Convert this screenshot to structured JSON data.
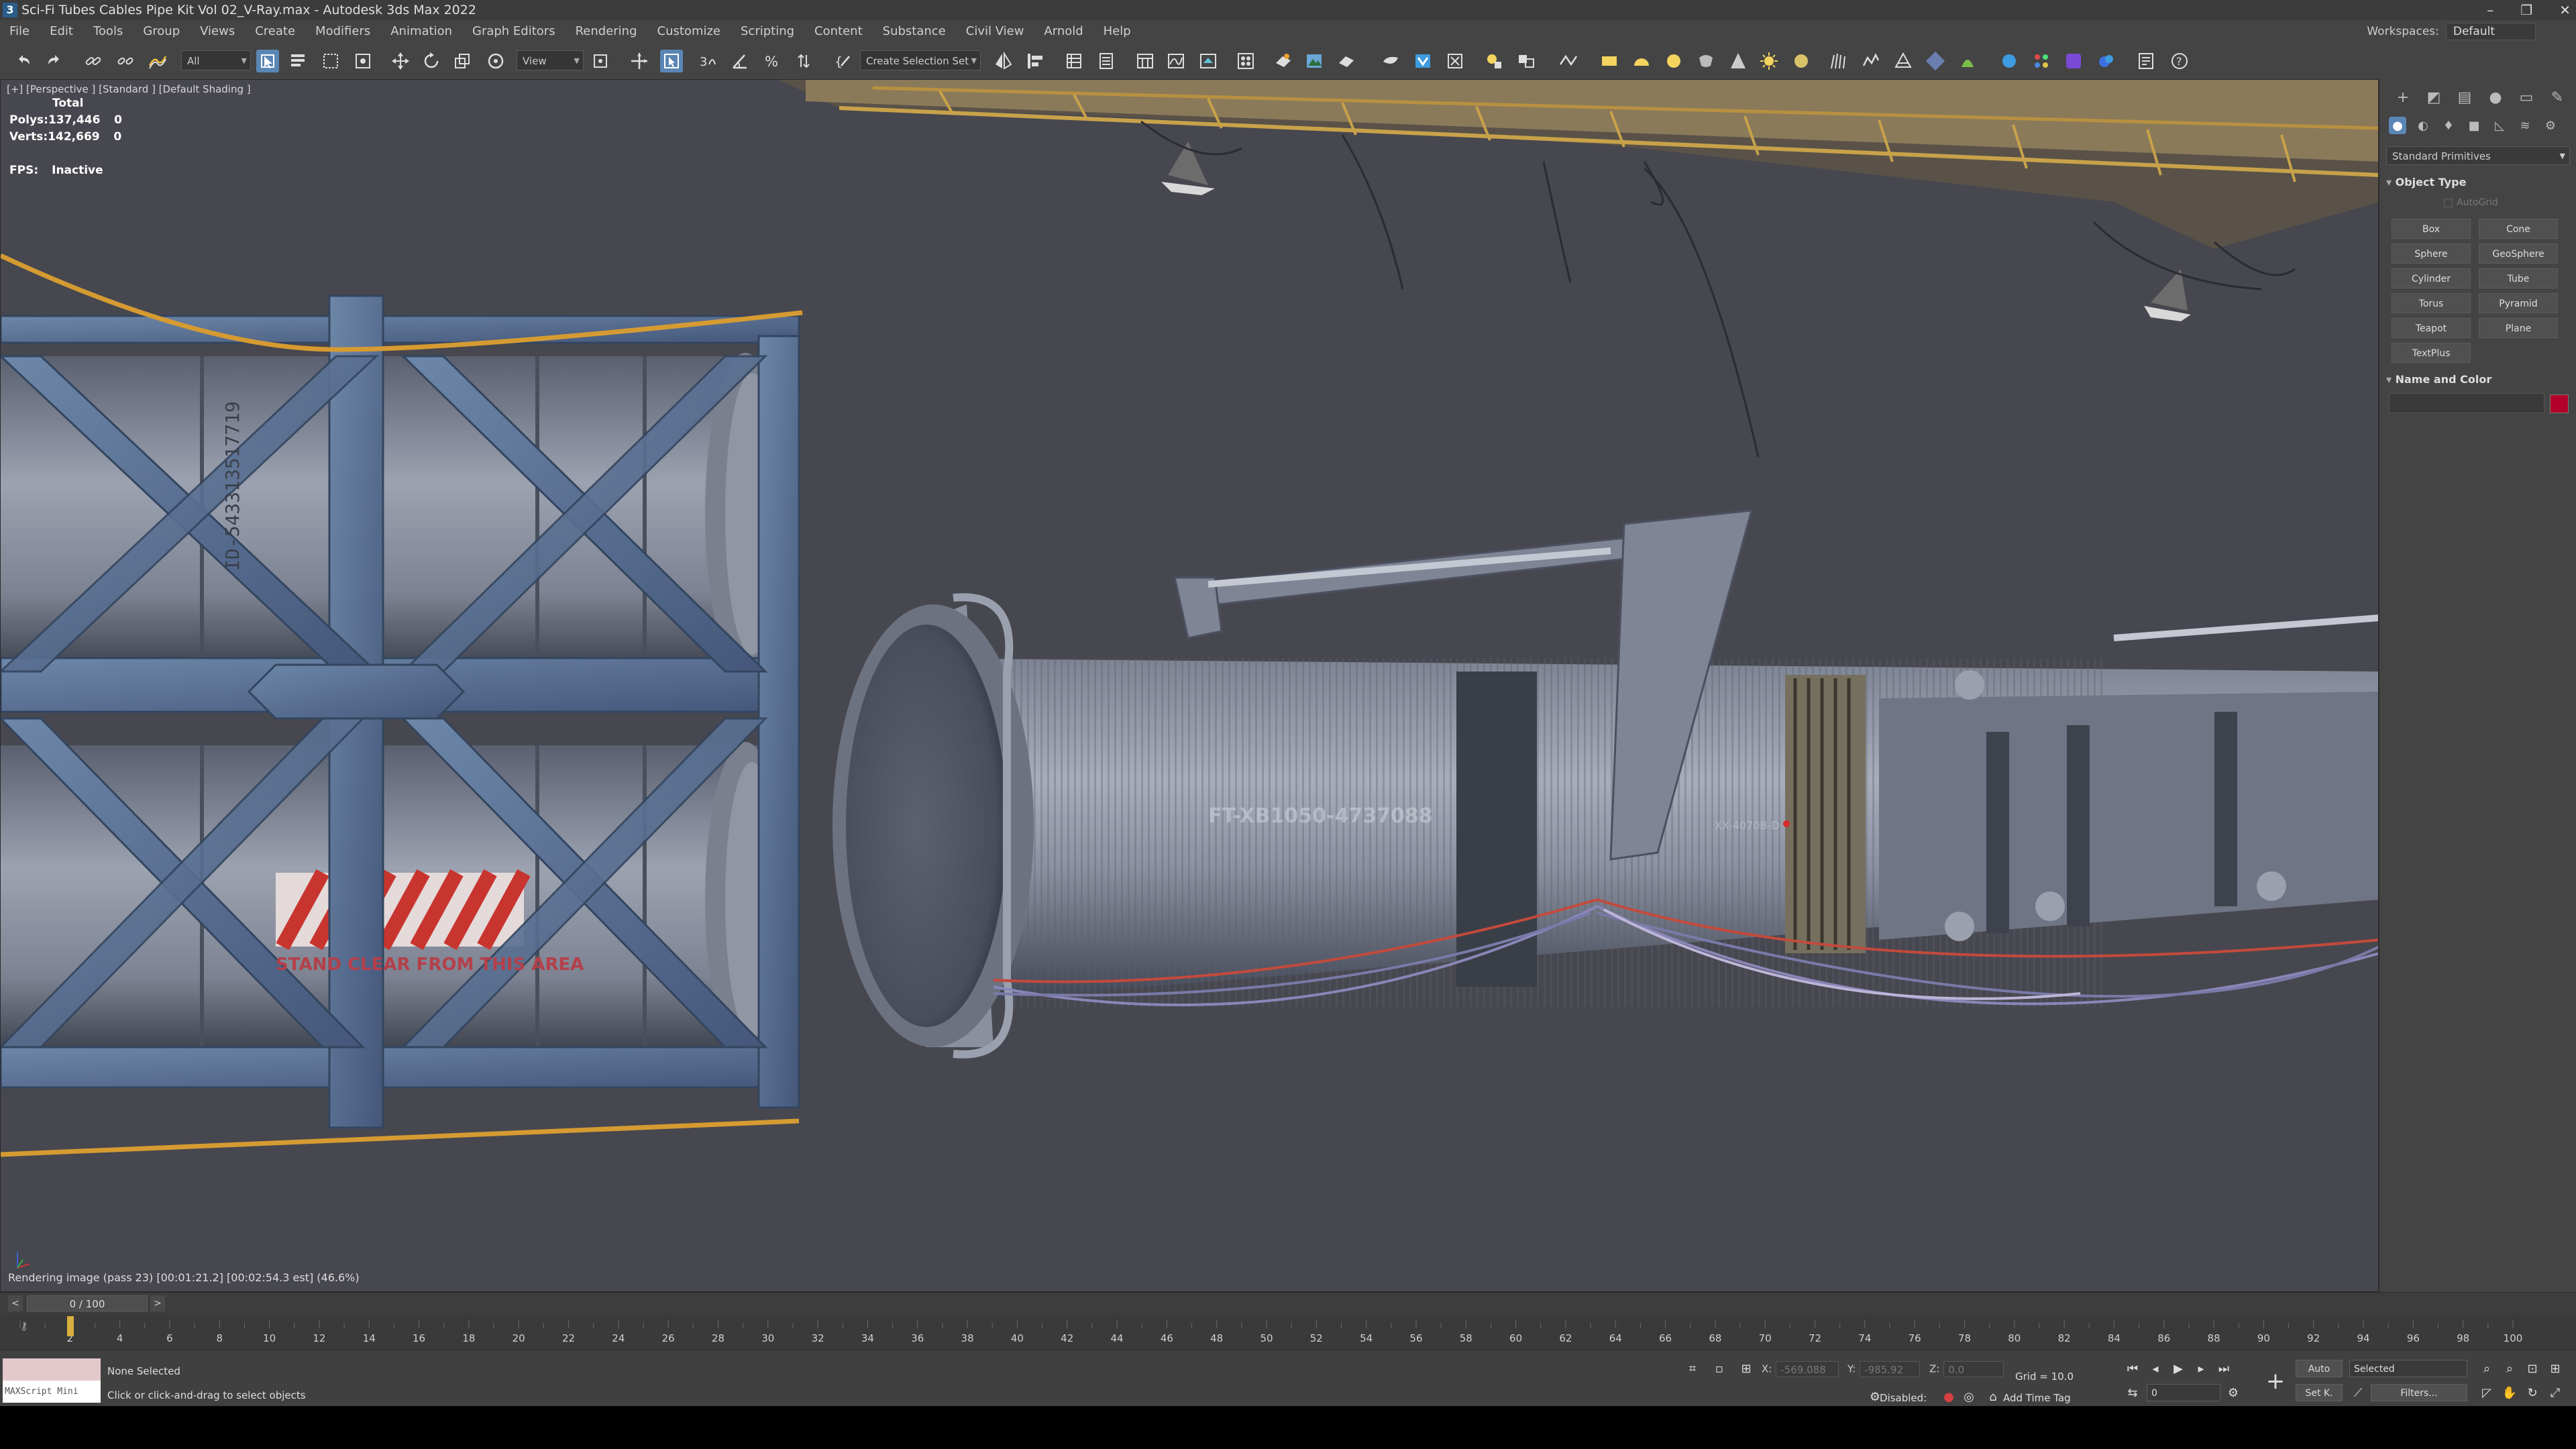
{
  "window": {
    "title": "Sci-Fi Tubes Cables Pipe Kit Vol 02_V-Ray.max - Autodesk 3ds Max 2022",
    "app_icon": "3"
  },
  "menu": [
    "File",
    "Edit",
    "Tools",
    "Group",
    "Views",
    "Create",
    "Modifiers",
    "Animation",
    "Graph Editors",
    "Rendering",
    "Customize",
    "Scripting",
    "Content",
    "Substance",
    "Civil View",
    "Arnold",
    "Help"
  ],
  "workspaces": {
    "label": "Workspaces:",
    "value": "Default"
  },
  "toolbar": {
    "selection_filter": "All",
    "ref_coord": "View",
    "selection_set": "Create Selection Set"
  },
  "viewport": {
    "label": "[+] [Perspective ] [Standard ] [Default Shading ]",
    "stats_header": "Total",
    "polys_label": "Polys:",
    "polys_value": "137,446",
    "polys_sel": "0",
    "verts_label": "Verts:",
    "verts_value": "142,669",
    "verts_sel": "0",
    "fps_label": "FPS:",
    "fps_value": "Inactive",
    "render_status": "Rendering image (pass 23) [00:01:21.2] [00:02:54.3 est]    (46.6%)",
    "decals": {
      "tank_id": "ID-543313517719",
      "warning": "STAND CLEAR FROM THIS AREA",
      "tube_id": "FT-XB1050-4737088",
      "small_id": "XX-4070B-D"
    }
  },
  "command_panel": {
    "category": "Standard Primitives",
    "object_type_title": "Object Type",
    "autogrid": "AutoGrid",
    "buttons": [
      "Box",
      "Cone",
      "Sphere",
      "GeoSphere",
      "Cylinder",
      "Tube",
      "Torus",
      "Pyramid",
      "Teapot",
      "Plane",
      "TextPlus"
    ],
    "name_color_title": "Name and Color",
    "object_color": "#b3002a"
  },
  "timeline": {
    "frame_display": "0 / 100",
    "ticks": [
      "0",
      "2",
      "4",
      "6",
      "8",
      "10",
      "12",
      "14",
      "16",
      "18",
      "20",
      "22",
      "24",
      "26",
      "28",
      "30",
      "32",
      "34",
      "36",
      "38",
      "40",
      "42",
      "44",
      "46",
      "48",
      "50",
      "52",
      "54",
      "56",
      "58",
      "60",
      "62",
      "64",
      "66",
      "68",
      "70",
      "72",
      "74",
      "76",
      "78",
      "80",
      "82",
      "84",
      "86",
      "88",
      "90",
      "92",
      "94",
      "96",
      "98",
      "100"
    ]
  },
  "status": {
    "maxscript": "MAXScript Mini",
    "selection": "None Selected",
    "prompt": "Click or click-and-drag to select objects",
    "x_label": "X:",
    "x_value": "-569.088",
    "y_label": "Y:",
    "y_value": "-985.92",
    "z_label": "Z:",
    "z_value": "0.0",
    "grid": "Grid = 10.0",
    "disabled": "Disabled:",
    "add_time_tag": "Add Time Tag",
    "auto_key": "Auto",
    "set_key": "Set K.",
    "key_filter": "Selected",
    "filters": "Filters...",
    "current_frame": "0"
  }
}
